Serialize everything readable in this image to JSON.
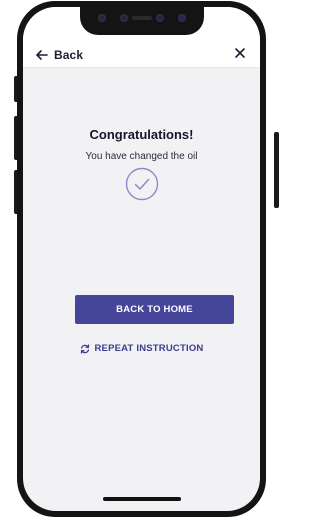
{
  "header": {
    "back_label": "Back",
    "back_icon": "arrow-left-icon",
    "close_icon": "close-icon"
  },
  "main": {
    "status_icon": "check-circle-icon",
    "title": "Congratulations!",
    "message": "You have changed the oil",
    "primary_button_label": "BACK TO HOME",
    "secondary_button_label": "REPEAT INSTRUCTION",
    "secondary_button_icon": "refresh-icon"
  },
  "colors": {
    "accent": "#45459a",
    "accent_text": "#3c3c8c",
    "check_ring": "#8b8bc7",
    "background": "#f2f2f5"
  }
}
